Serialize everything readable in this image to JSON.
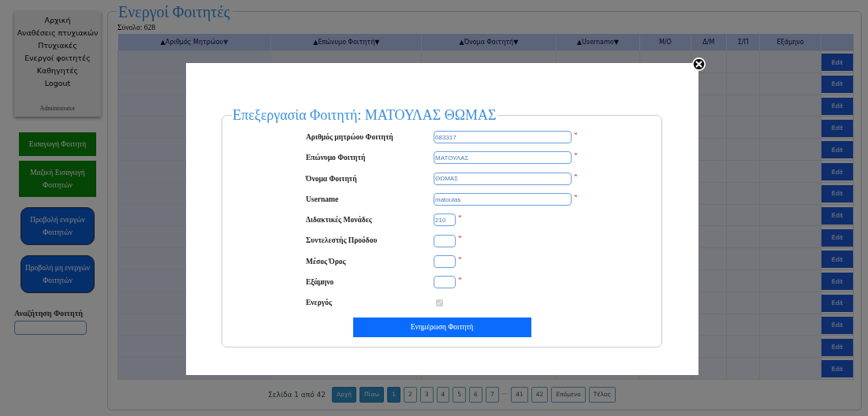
{
  "nav": {
    "items": [
      {
        "label": "Αρχική"
      },
      {
        "label": "Αναθέσεις πτυχιακών"
      },
      {
        "label": "Πτυχιακές"
      },
      {
        "label": "Ενεργοί φοιτητές"
      },
      {
        "label": "Καθηγητές"
      },
      {
        "label": "Logout"
      }
    ],
    "role": "Administrator"
  },
  "actions": [
    {
      "label": "Εισαγωγή Φοιτητή",
      "kind": "green"
    },
    {
      "label": "Μαζική Εισαγωγή Φοιτητών",
      "kind": "green"
    },
    {
      "label": "Προβολή ενεργών Φοιτητών",
      "kind": "blue"
    },
    {
      "label": "Προβολή μη ενεργών Φοιτητών",
      "kind": "blue"
    }
  ],
  "search": {
    "label": "Αναζήτηση Φοιτητή"
  },
  "page": {
    "title": "Ενεργοί Φοιτητές",
    "total": "Σύνολο: 628"
  },
  "table": {
    "columns": [
      {
        "up": "▲",
        "label": "Αριθμός Μητρώου",
        "down": "▼",
        "down_dimmed": true
      },
      {
        "up": "▲",
        "label": "Επώνυμο Φοιτητή",
        "down": "▼",
        "down_dimmed": false
      },
      {
        "up": "▲",
        "label": "Όνομα Φοιτητή",
        "down": "▼",
        "down_dimmed": false
      },
      {
        "up": "▲",
        "label": "Username",
        "down": "▼",
        "down_dimmed": false
      },
      {
        "label": "Μ/Ο"
      },
      {
        "label": "Δ/Μ"
      },
      {
        "label": "Σ/Π"
      },
      {
        "label": "Εξάμηνο"
      }
    ],
    "rows": [
      {
        "action": "Edit"
      },
      {
        "action": "Edit"
      },
      {
        "action": "Edit"
      },
      {
        "action": "Edit"
      },
      {
        "action": "Edit"
      },
      {
        "action": "Edit"
      },
      {
        "action": "Edit"
      },
      {
        "action": "Edit"
      },
      {
        "action": "Edit"
      },
      {
        "action": "Edit"
      },
      {
        "action": "Edit"
      },
      {
        "action": "Edit"
      },
      {
        "action": "Edit"
      },
      {
        "action": "Edit"
      },
      {
        "action": "Edit"
      }
    ]
  },
  "pagination": {
    "summary": "Σελίδα 1 από 42",
    "items": [
      {
        "label": "Αρχή",
        "kind": "page",
        "selected": true
      },
      {
        "label": "Πίσω",
        "kind": "page",
        "selected": true
      },
      {
        "label": "1",
        "kind": "page",
        "selected": true
      },
      {
        "label": "2",
        "kind": "page",
        "selected": false
      },
      {
        "label": "3",
        "kind": "page",
        "selected": false
      },
      {
        "label": "4",
        "kind": "page",
        "selected": false
      },
      {
        "label": "5",
        "kind": "page",
        "selected": false
      },
      {
        "label": "6",
        "kind": "page",
        "selected": false
      },
      {
        "label": "7",
        "kind": "page",
        "selected": false
      },
      {
        "label": "···",
        "kind": "ellipsis"
      },
      {
        "label": "41",
        "kind": "page",
        "selected": false
      },
      {
        "label": "42",
        "kind": "page",
        "selected": false
      },
      {
        "label": "Επόμενο",
        "kind": "page",
        "selected": false
      },
      {
        "label": "Τέλος",
        "kind": "page",
        "selected": false
      }
    ]
  },
  "modal": {
    "title": "Επεξεργασία Φοιτητή: ΜΑΤΟΥΛΑΣ ΘΩΜΑΣ",
    "fields": [
      {
        "label": "Αριθμός μητρώου Φοιτητή",
        "kind": "wide",
        "value": "083317",
        "required": "*"
      },
      {
        "label": "Επώνυμο Φοιτητή",
        "kind": "wide",
        "value": "ΜΑΤΟΥΛΑΣ",
        "required": "*"
      },
      {
        "label": "Όνομα Φοιτητή",
        "kind": "wide",
        "value": "ΘΩΜΑΣ",
        "required": "*"
      },
      {
        "label": "Username",
        "kind": "wide",
        "value": "matoulas",
        "required": "*"
      },
      {
        "label": "Διδακτικές Μονάδες",
        "kind": "narrow",
        "value": "210",
        "required": "*"
      },
      {
        "label": "Συντελεστής Προόδου",
        "kind": "narrow",
        "required": "*"
      },
      {
        "label": "Μέσος Όρος",
        "kind": "narrow",
        "required": "*"
      },
      {
        "label": "Εξάμηνο",
        "kind": "narrow",
        "required": "*"
      },
      {
        "label": "Ενεργός",
        "kind": "checkbox",
        "checked": true
      }
    ],
    "submit": "Ενημέρωση Φοιτητή"
  }
}
